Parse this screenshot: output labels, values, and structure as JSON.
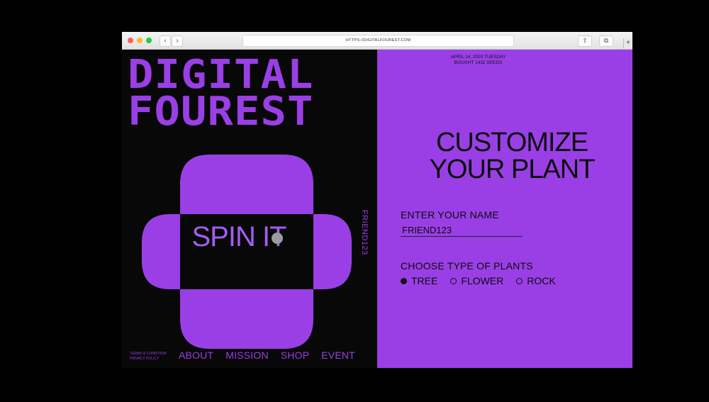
{
  "browser": {
    "url": "HTTPS://DIGITALFOUREST.COM",
    "back_icon": "chevron-left-icon",
    "forward_icon": "chevron-right-icon",
    "share_icon": "share-icon",
    "tabs_icon": "tabs-icon",
    "corner_icon": "plus-icon"
  },
  "logo": {
    "line1": "DIGITAL",
    "line2": "FOUREST"
  },
  "hero": {
    "spin_label": "SPIN IT",
    "vertical_label": "FRIEND123"
  },
  "footer": {
    "legal": [
      "TERMS & CONDITION",
      "PRIVACY POLICY"
    ],
    "nav": [
      "ABOUT",
      "MISSION",
      "SHOP",
      "EVENT"
    ]
  },
  "panel": {
    "date_line": "APRIL 14, 2020 TUESDAY",
    "seeds_line": "BOUGHT 1432 SEEDS",
    "heading_line1": "CUSTOMIZE",
    "heading_line2": "YOUR PLANT",
    "name_label": "ENTER YOUR NAME",
    "name_value": "FRIEND123",
    "type_label": "CHOOSE TYPE OF PLANTS",
    "plant_types": [
      "TREE",
      "FLOWER",
      "ROCK"
    ],
    "selected_type": "TREE"
  },
  "colors": {
    "accent": "#9a3fe6",
    "background": "#080808",
    "panel": "#9a3fe6",
    "text": "#0b0b0b"
  }
}
